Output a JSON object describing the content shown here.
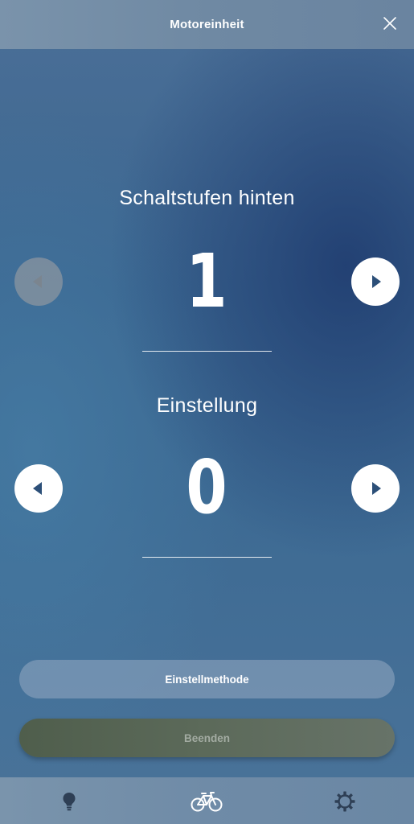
{
  "header": {
    "title": "Motoreinheit",
    "close_icon": "close-icon"
  },
  "rear_gears": {
    "label": "Schaltstufen hinten",
    "value": "1",
    "prev_icon": "chevron-left-icon",
    "next_icon": "chevron-right-icon",
    "prev_disabled": true
  },
  "adjustment": {
    "label": "Einstellung",
    "value": "0",
    "prev_icon": "chevron-left-icon",
    "next_icon": "chevron-right-icon"
  },
  "buttons": {
    "method_label": "Einstellmethode",
    "finish_label": "Beenden"
  },
  "tabbar": {
    "items": [
      {
        "icon": "lightbulb-icon"
      },
      {
        "icon": "bicycle-icon"
      },
      {
        "icon": "gear-icon"
      }
    ]
  },
  "colors": {
    "header_bg": "#7490aa",
    "accent_white": "#ffffff",
    "arrow_fill": "#2c4f78",
    "disabled_btn": "#8c96a0",
    "finish_bg": "#5c6a5a"
  }
}
